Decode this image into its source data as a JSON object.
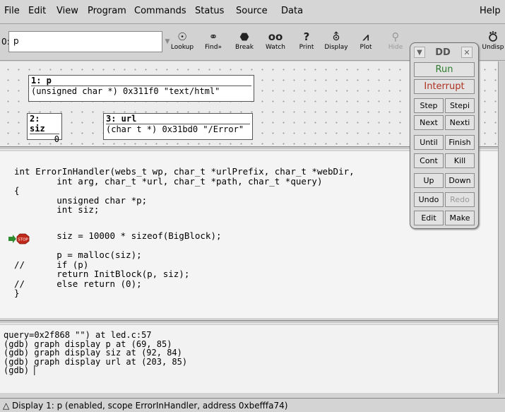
{
  "menubar": {
    "items": [
      "File",
      "Edit",
      "View",
      "Program",
      "Commands",
      "Status",
      "Source",
      "Data"
    ],
    "help": "Help"
  },
  "toolbar": {
    "arg_label": "0:",
    "arg_value": "p",
    "buttons": [
      {
        "label": "Lookup",
        "icon": "lookup-icon"
      },
      {
        "label": "Find»",
        "icon": "find-icon"
      },
      {
        "label": "Break",
        "icon": "break-icon"
      },
      {
        "label": "Watch",
        "icon": "watch-icon"
      },
      {
        "label": "Print",
        "icon": "print-icon"
      },
      {
        "label": "Display",
        "icon": "display-icon"
      },
      {
        "label": "Plot",
        "icon": "plot-icon"
      },
      {
        "label": "Hide",
        "icon": "hide-icon"
      },
      {
        "label": "Undisp",
        "icon": "undisp-icon"
      }
    ]
  },
  "data_window": {
    "displays": [
      {
        "title": "1: p",
        "value": "(unsigned char *) 0x311f0 \"text/html\""
      },
      {
        "title": "2: siz",
        "value": "0"
      },
      {
        "title": "3: url",
        "value": "(char t *) 0x31bd0 \"/Error\""
      }
    ]
  },
  "source": {
    "lines": [
      "int ErrorInHandler(webs_t wp, char_t *urlPrefix, char_t *webDir,",
      "        int arg, char_t *url, char_t *path, char_t *query)",
      "{",
      "        unsigned char *p;",
      "        int siz;",
      "",
      "        siz = 10000 * sizeof(BigBlock);",
      "",
      "        p = malloc(siz);",
      "//      if (p)",
      "        return InitBlock(p, siz);",
      "//      else return (0);",
      "}"
    ],
    "breakpoint_label": "STOP"
  },
  "console": {
    "lines": [
      "query=0x2f868 \"\") at led.c:57",
      "(gdb) graph display p at (69, 85)",
      "(gdb) graph display siz at (92, 84)",
      "(gdb) graph display url at (203, 85)",
      "(gdb) "
    ]
  },
  "status": {
    "text": "Display 1: p (enabled, scope ErrorInHandler, address 0xbefffa74)"
  },
  "ddtool": {
    "title": "DD",
    "run": "Run",
    "interrupt": "Interrupt",
    "buttons": [
      [
        "Step",
        "Stepi"
      ],
      [
        "Next",
        "Nexti"
      ],
      [
        "Until",
        "Finish"
      ],
      [
        "Cont",
        "Kill"
      ],
      [
        "Up",
        "Down"
      ],
      [
        "Undo",
        "Redo"
      ],
      [
        "Edit",
        "Make"
      ]
    ],
    "colors": {
      "run": "#2e7d2e",
      "interrupt": "#b03020",
      "disabled": "#9a9a9a"
    }
  }
}
